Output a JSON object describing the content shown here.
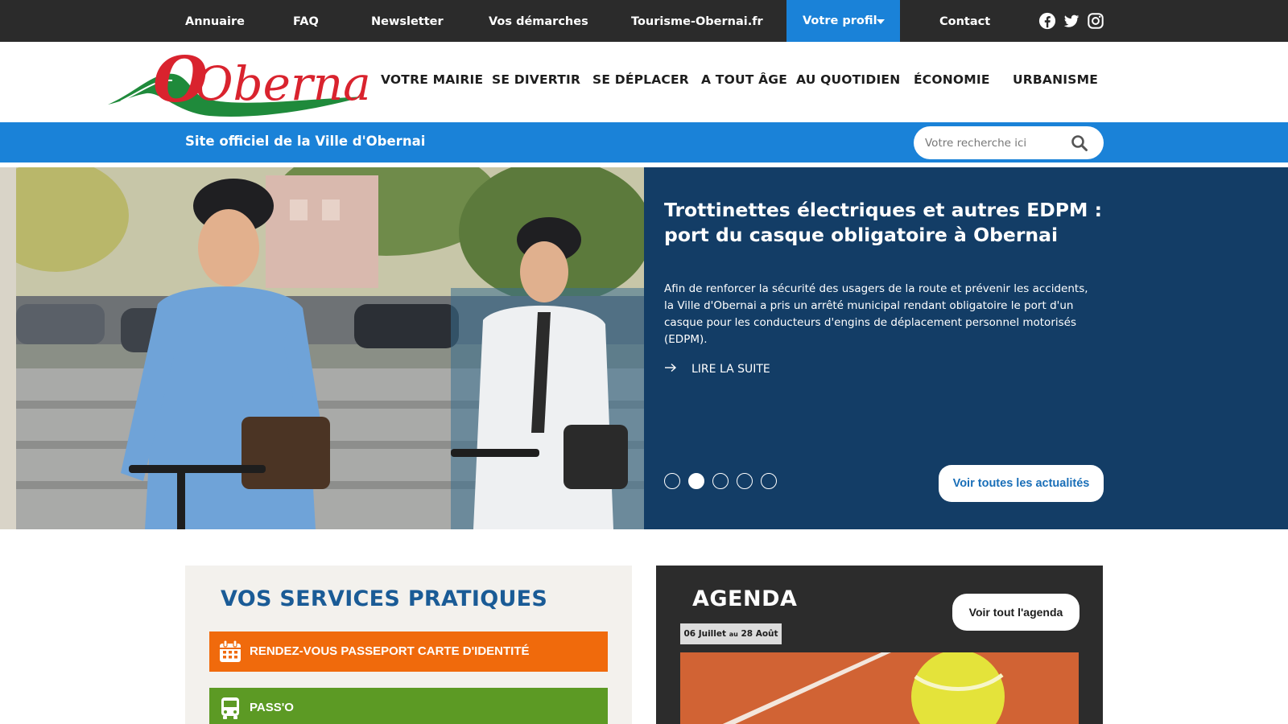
{
  "topbar": {
    "links": [
      "Annuaire",
      "FAQ",
      "Newsletter",
      "Vos démarches",
      "Tourisme-Obernai.fr"
    ],
    "profile_label": "Votre profil",
    "contact_label": "Contact",
    "social_icons": [
      "facebook-icon",
      "twitter-icon",
      "instagram-icon"
    ]
  },
  "header": {
    "logo_text": "Obernai",
    "nav": [
      "VOTRE MAIRIE",
      "SE DIVERTIR",
      "SE DÉPLACER",
      "A TOUT ÂGE",
      "AU QUOTIDIEN",
      "ÉCONOMIE",
      "URBANISME"
    ]
  },
  "bluebar": {
    "site_title": "Site officiel de la Ville d'Obernai",
    "search_placeholder": "Votre recherche ici"
  },
  "hero": {
    "headline": "Trottinettes électriques et autres EDPM : port du casque obligatoire à Obernai",
    "excerpt": "Afin de renforcer la sécurité des usagers de la route et prévenir les accidents, la Ville d'Obernai a pris un arrêté municipal rendant obligatoire le port d'un casque pour les conducteurs d'engins de déplacement personnel motorisés (EDPM).",
    "read_more": "LIRE LA SUITE",
    "slides_total": 5,
    "active_slide": 2,
    "all_news_label": "Voir toutes les actualités",
    "panel_color": "#133d66"
  },
  "services": {
    "title": "VOS SERVICES PRATIQUES",
    "items": [
      {
        "label": "RENDEZ-VOUS PASSEPORT CARTE D'IDENTITÉ",
        "color": "#f06a0c",
        "icon": "calendar-icon"
      },
      {
        "label": "PASS'O",
        "color": "#5c9a24",
        "icon": "bus-icon"
      }
    ]
  },
  "agenda": {
    "title": "AGENDA",
    "all_label": "Voir tout l'agenda",
    "date_start": "06 Juillet",
    "date_sep": "au",
    "date_end": "28 Août"
  },
  "colors": {
    "topbar": "#2b2b2b",
    "accent_blue": "#1a82d8",
    "title_blue": "#1a5b96"
  }
}
